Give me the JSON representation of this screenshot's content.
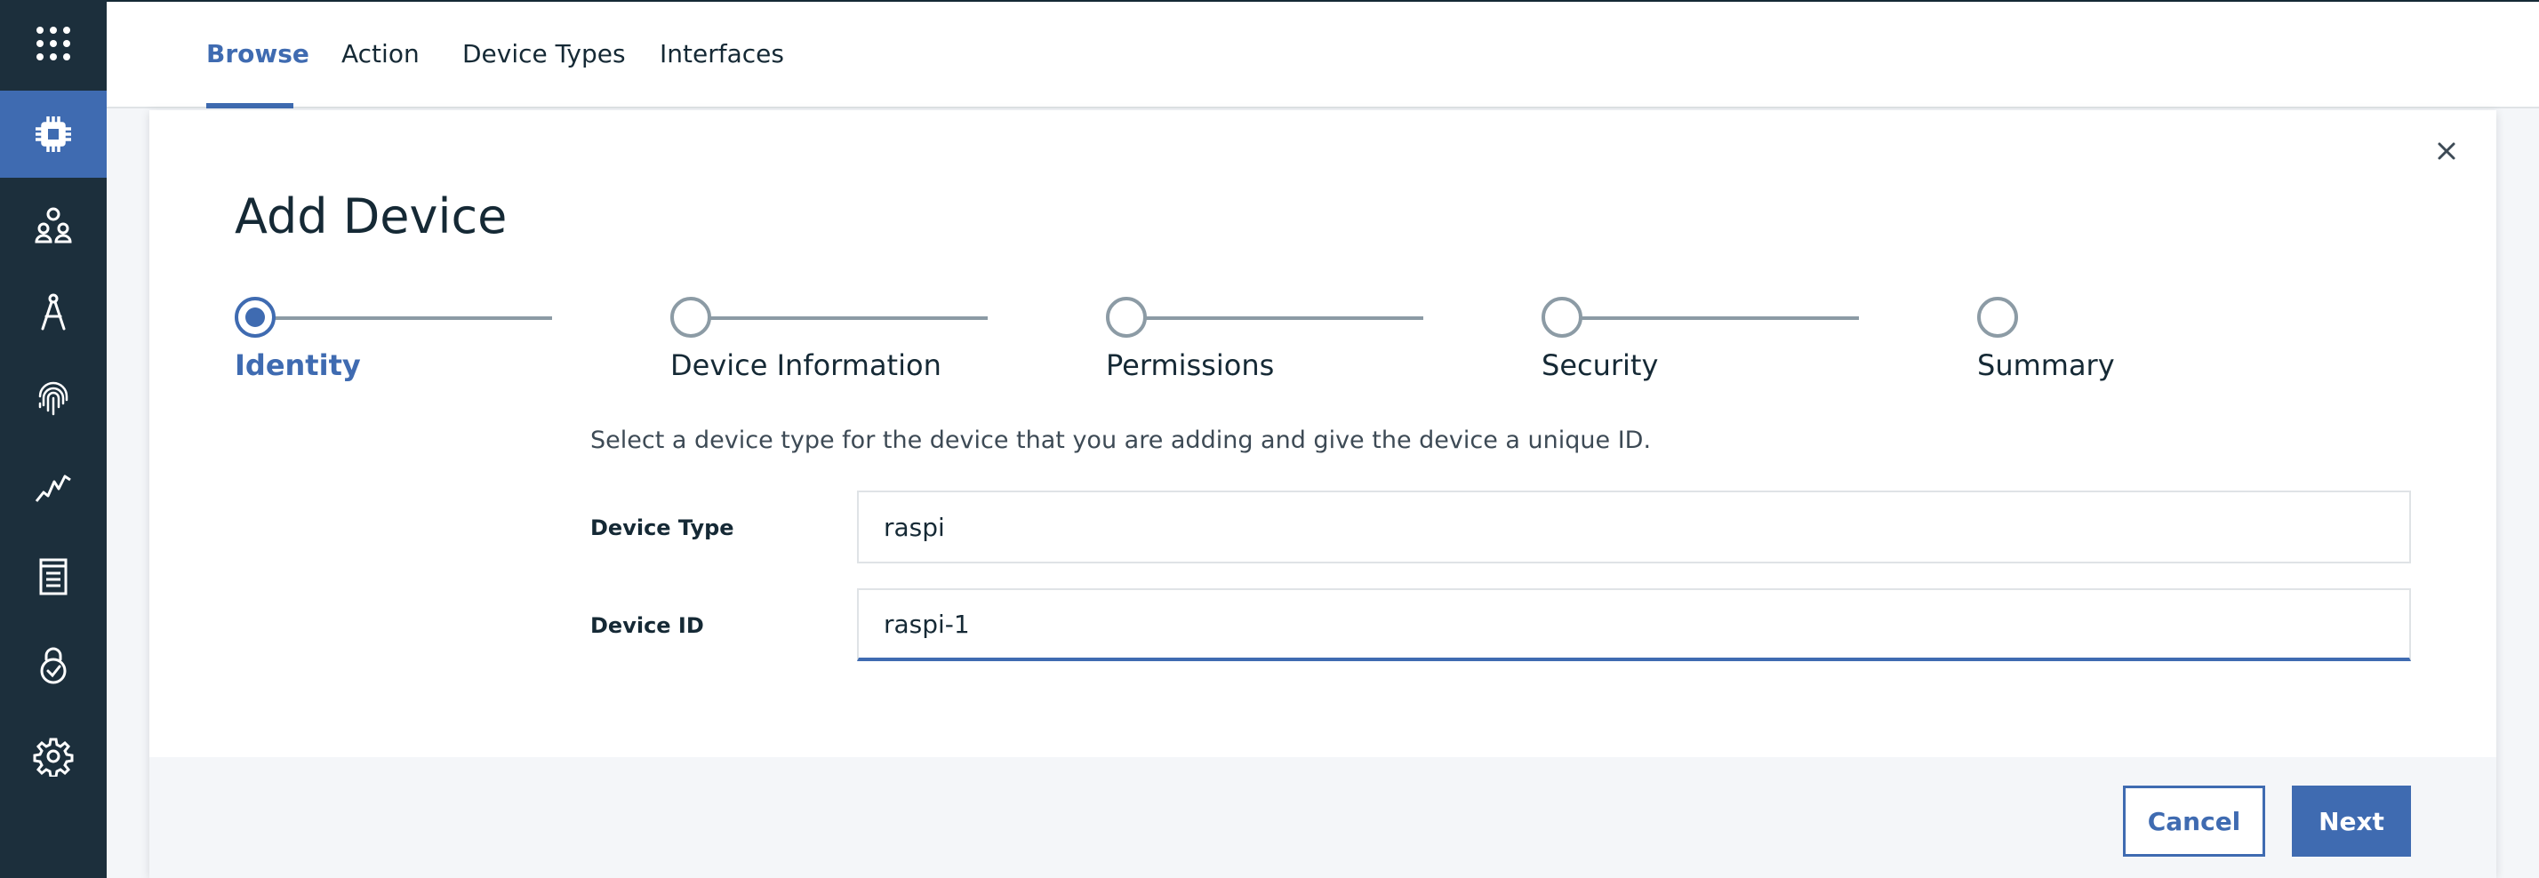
{
  "nav": {
    "tabs": [
      {
        "label": "Browse",
        "active": true
      },
      {
        "label": "Action",
        "active": false
      },
      {
        "label": "Device Types",
        "active": false
      },
      {
        "label": "Interfaces",
        "active": false
      }
    ]
  },
  "sidebar": {
    "items": [
      {
        "icon": "app-switcher-icon"
      },
      {
        "icon": "chip-icon",
        "active": true
      },
      {
        "icon": "members-icon"
      },
      {
        "icon": "compass-draw-icon"
      },
      {
        "icon": "fingerprint-icon"
      },
      {
        "icon": "analytics-icon"
      },
      {
        "icon": "document-icon"
      },
      {
        "icon": "lock-check-icon"
      },
      {
        "icon": "settings-icon"
      }
    ]
  },
  "modal": {
    "title": "Add Device",
    "steps": [
      {
        "label": "Identity",
        "current": true
      },
      {
        "label": "Device Information",
        "current": false
      },
      {
        "label": "Permissions",
        "current": false
      },
      {
        "label": "Security",
        "current": false
      },
      {
        "label": "Summary",
        "current": false
      }
    ],
    "instructions": "Select a device type for the device that you are adding and give the device a unique ID.",
    "fields": {
      "device_type": {
        "label": "Device Type",
        "value": "raspi"
      },
      "device_id": {
        "label": "Device ID",
        "value": "raspi-1"
      }
    },
    "buttons": {
      "cancel": "Cancel",
      "next": "Next"
    }
  },
  "colors": {
    "accent": "#3f6bb1",
    "sidebar": "#1c2f3c",
    "text": "#152935",
    "step_inactive": "#8c9ba5"
  }
}
